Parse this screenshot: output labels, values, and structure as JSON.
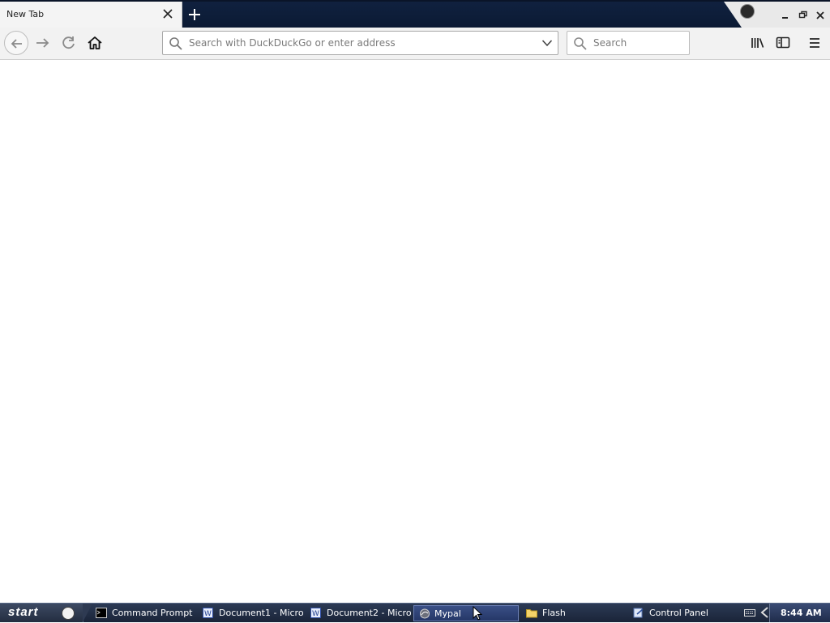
{
  "browser": {
    "tab": {
      "title": "New Tab"
    },
    "urlbar": {
      "placeholder": "Search with DuckDuckGo or enter address",
      "value": ""
    },
    "searchbar": {
      "placeholder": "Search",
      "value": ""
    }
  },
  "taskbar": {
    "start_label": "start",
    "items": [
      {
        "label": "Command Prompt",
        "icon": "terminal-icon",
        "active": false
      },
      {
        "label": "Document1 - Micro...",
        "icon": "word-doc-icon",
        "active": false
      },
      {
        "label": "Document2 - Micro...",
        "icon": "word-doc-icon",
        "active": false
      },
      {
        "label": "Mypal",
        "icon": "mypal-browser-icon",
        "active": true
      },
      {
        "label": "Flash",
        "icon": "folder-icon",
        "active": false
      },
      {
        "label": "Control Panel",
        "icon": "control-panel-icon",
        "active": false
      }
    ],
    "clock": "8:44 AM"
  },
  "colors": {
    "titlebar": "#0b1a34",
    "toolbar": "#f2f2f2",
    "taskbar": "#1a2438",
    "active_task": "#253767"
  }
}
